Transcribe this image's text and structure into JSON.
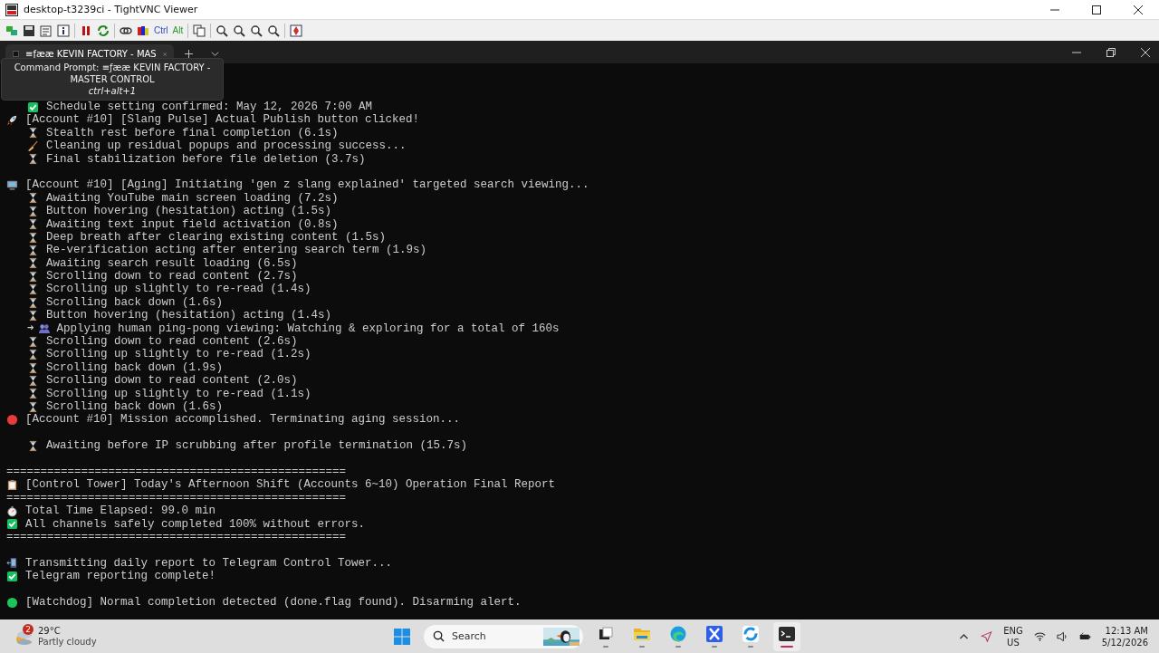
{
  "window": {
    "title": "desktop-t3239ci - TightVNC Viewer"
  },
  "toolbar": {
    "ctrl_label": "Ctrl",
    "alt_label": "Alt"
  },
  "terminal": {
    "tab": {
      "title": "≡ƒææ KEVIN FACTORY - MAS",
      "selected": true
    },
    "tooltip": {
      "title": "Command Prompt: ≡ƒææ KEVIN FACTORY - MASTER CONTROL",
      "shortcut": "ctrl+alt+1"
    },
    "blocks": [
      {
        "children": [
          {
            "kind": "check",
            "text": "Schedule setting confirmed: May 12, 2026 7:00 AM"
          }
        ],
        "lines": [
          {
            "kind": "rocket",
            "text": "[Account #10] [Slang Pulse] Actual Publish button clicked!",
            "children": [
              {
                "kind": "hourglass",
                "text": "Stealth rest before final completion (6.1s)"
              },
              {
                "kind": "broom",
                "text": "Cleaning up residual popups and processing success..."
              },
              {
                "kind": "hourglass",
                "text": "Final stabilization before file deletion (3.7s)"
              }
            ]
          }
        ]
      },
      {
        "lines": [
          {
            "kind": "monitor",
            "text": "[Account #10] [Aging] Initiating 'gen z slang explained' targeted search viewing...",
            "children": [
              {
                "kind": "hourglass",
                "text": "Awaiting YouTube main screen loading (7.2s)"
              },
              {
                "kind": "hourglass",
                "text": "Button hovering (hesitation) acting (1.5s)"
              },
              {
                "kind": "hourglass",
                "text": "Awaiting text input field activation (0.8s)"
              },
              {
                "kind": "hourglass",
                "text": "Deep breath after clearing existing content (1.5s)"
              },
              {
                "kind": "hourglass",
                "text": "Re-verification acting after entering search term (1.9s)"
              },
              {
                "kind": "hourglass",
                "text": "Awaiting search result loading (6.5s)"
              },
              {
                "kind": "hourglass",
                "text": "Scrolling down to read content (2.7s)"
              },
              {
                "kind": "hourglass",
                "text": "Scrolling up slightly to re-read (1.4s)"
              },
              {
                "kind": "hourglass",
                "text": "Scrolling back down (1.6s)"
              },
              {
                "kind": "hourglass",
                "text": "Button hovering (hesitation) acting (1.4s)"
              },
              {
                "kind": "people",
                "prefix": "➜",
                "text": "Applying human ping-pong viewing: Watching & exploring for a total of 160s"
              },
              {
                "kind": "hourglass",
                "text": "Scrolling down to read content (2.6s)"
              },
              {
                "kind": "hourglass",
                "text": "Scrolling up slightly to re-read (1.2s)"
              },
              {
                "kind": "hourglass",
                "text": "Scrolling back down (1.9s)"
              },
              {
                "kind": "hourglass",
                "text": "Scrolling down to read content (2.0s)"
              },
              {
                "kind": "hourglass",
                "text": "Scrolling up slightly to re-read (1.1s)"
              },
              {
                "kind": "hourglass",
                "text": "Scrolling back down (1.6s)"
              }
            ]
          },
          {
            "kind": "stop-dot",
            "text": "[Account #10] Mission accomplished. Terminating aging session..."
          }
        ]
      },
      {
        "children": [
          {
            "kind": "hourglass",
            "text": "Awaiting before IP scrubbing after profile termination (15.7s)"
          }
        ]
      },
      {
        "lines": [
          {
            "kind": "rule",
            "text": "=================================================="
          },
          {
            "kind": "clipboard",
            "text": "[Control Tower] Today's Afternoon Shift (Accounts 6~10) Operation Final Report"
          },
          {
            "kind": "rule",
            "text": "=================================================="
          },
          {
            "kind": "stopwatch",
            "text": "Total Time Elapsed: 99.0 min"
          },
          {
            "kind": "check",
            "text": "All channels safely completed 100% without errors."
          },
          {
            "kind": "rule",
            "text": "=================================================="
          }
        ]
      },
      {
        "lines": [
          {
            "kind": "phone",
            "text": "Transmitting daily report to Telegram Control Tower..."
          },
          {
            "kind": "check",
            "text": "Telegram reporting complete!"
          }
        ]
      },
      {
        "lines": [
          {
            "kind": "status-dot",
            "text": "[Watchdog] Normal completion detected (done.flag found). Disarming alert."
          }
        ]
      }
    ]
  },
  "taskbar": {
    "weather": {
      "badge": "2",
      "temperature": "29°C",
      "condition": "Partly cloudy"
    },
    "search": {
      "placeholder": "Search"
    },
    "apps": [
      {
        "kind": "task-view",
        "selected": false
      },
      {
        "kind": "folder",
        "selected": false
      },
      {
        "kind": "edge",
        "selected": false
      },
      {
        "kind": "x-app",
        "selected": false
      },
      {
        "kind": "ring-app",
        "selected": false
      },
      {
        "kind": "terminal",
        "selected": true
      }
    ],
    "language": "ENG",
    "region": "US",
    "time": "12:13 AM",
    "date": "5/12/2026"
  }
}
